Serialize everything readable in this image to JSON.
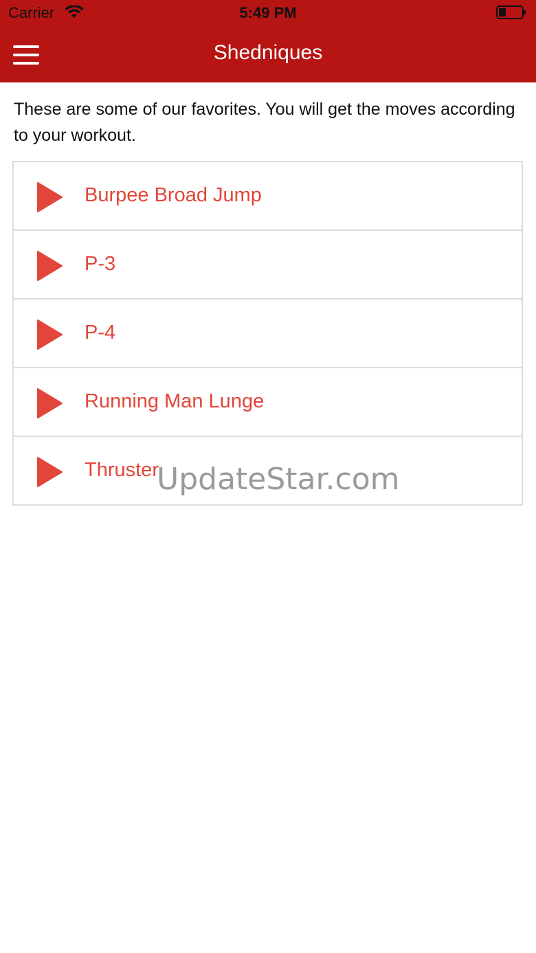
{
  "status_bar": {
    "carrier": "Carrier",
    "time": "5:49 PM",
    "wifi_icon": "wifi-icon",
    "battery_icon": "battery-icon"
  },
  "nav": {
    "title": "Shedniques",
    "menu_icon": "hamburger-menu-icon"
  },
  "intro_text": "These are some of our favorites. You will get the moves according to your workout.",
  "moves": [
    {
      "label": "Burpee Broad Jump",
      "icon": "play-icon"
    },
    {
      "label": "P-3",
      "icon": "play-icon"
    },
    {
      "label": "P-4",
      "icon": "play-icon"
    },
    {
      "label": "Running Man Lunge",
      "icon": "play-icon"
    },
    {
      "label": "Thruster",
      "icon": "play-icon"
    }
  ],
  "watermark": "UpdateStar.com",
  "colors": {
    "header": "#b71414",
    "accent": "#e2463a"
  }
}
